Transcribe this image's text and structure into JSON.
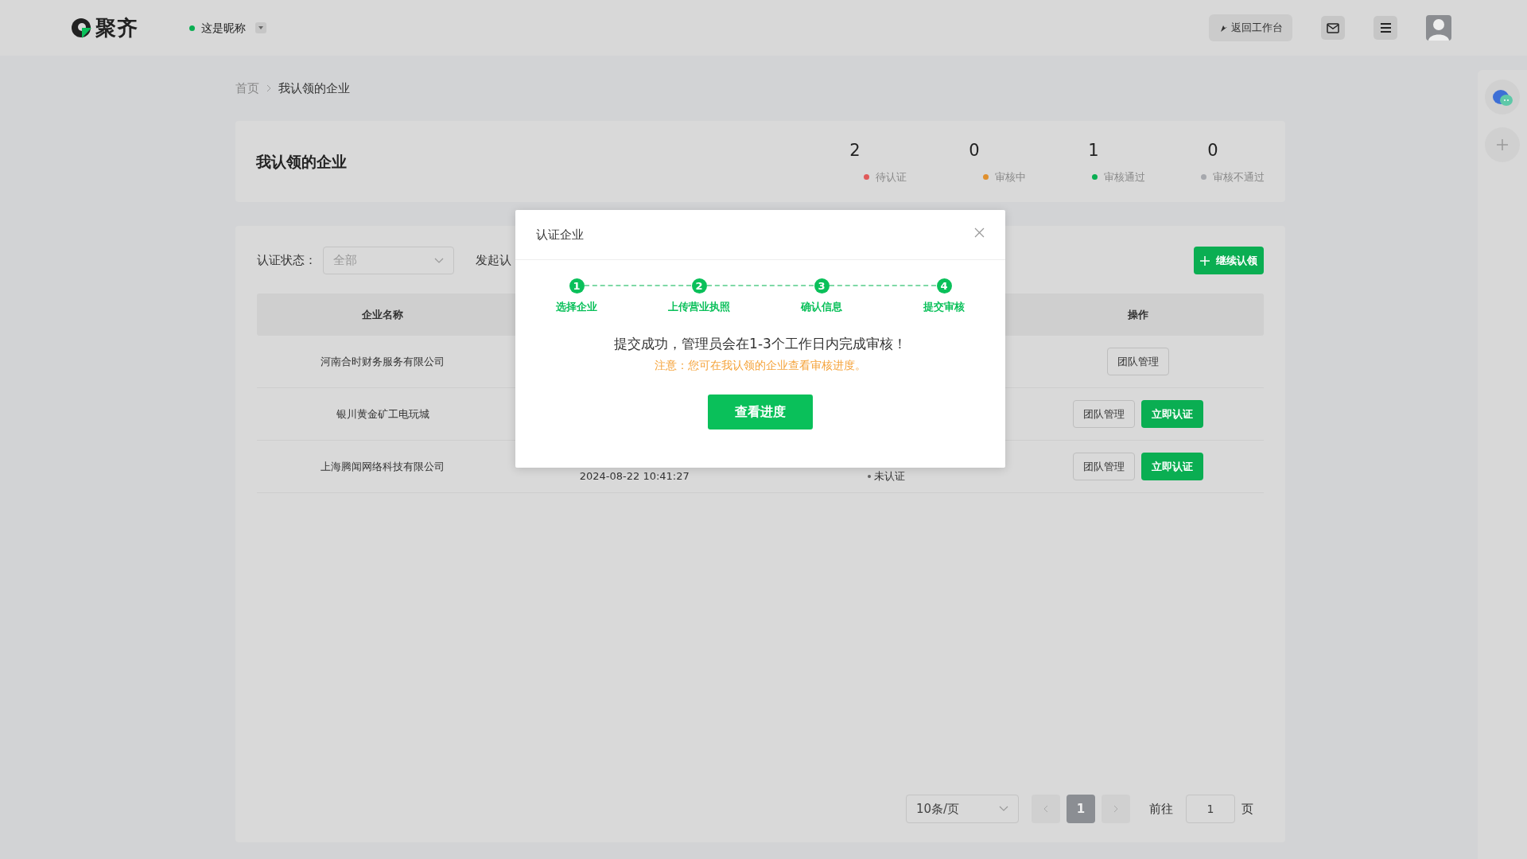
{
  "header": {
    "logo_text": "聚齐",
    "user": {
      "name": "这是昵称",
      "online": true
    },
    "workbench_button": "返回工作台"
  },
  "breadcrumb": [
    {
      "label": "首页",
      "current": false
    },
    {
      "label": "我认领的企业",
      "current": true
    }
  ],
  "summary": {
    "title": "我认领的企业",
    "stats": [
      {
        "count": "2",
        "label": "待认证",
        "color": "#e05a5a"
      },
      {
        "count": "0",
        "label": "审核中",
        "color": "#e0902e"
      },
      {
        "count": "1",
        "label": "审核通过",
        "color": "#0aae52"
      },
      {
        "count": "0",
        "label": "审核不通过",
        "color": "#a6a8ad"
      }
    ]
  },
  "filters": {
    "status_label": "认证状态：",
    "status_value": "全部",
    "date_label": "发起认"
  },
  "add_button": "继续认领",
  "table": {
    "columns": [
      "企业名称",
      "操作"
    ],
    "rows": [
      {
        "name": "河南合时财务服务有限公司",
        "actions": [
          {
            "label": "团队管理",
            "kind": "outline"
          }
        ]
      },
      {
        "name": "银川黄金矿工电玩城",
        "actions": [
          {
            "label": "团队管理",
            "kind": "outline"
          },
          {
            "label": "立即认证",
            "kind": "primary"
          }
        ]
      },
      {
        "name": "上海腾闻网络科技有限公司",
        "date": "2024-08-22 10:41:27",
        "status": "未认证",
        "actions": [
          {
            "label": "团队管理",
            "kind": "outline"
          },
          {
            "label": "立即认证",
            "kind": "primary"
          }
        ]
      }
    ]
  },
  "pagination": {
    "page_size": "10条/页",
    "pages": [
      {
        "label": "1",
        "selected": true
      }
    ],
    "goto_label": "前往",
    "goto_value": "1",
    "page_unit": "页"
  },
  "modal": {
    "title": "认证企业",
    "steps": [
      {
        "number": "1",
        "label": "选择企业",
        "completed": true
      },
      {
        "number": "2",
        "label": "上传营业执照",
        "completed": true
      },
      {
        "number": "3",
        "label": "确认信息",
        "completed": true
      },
      {
        "number": "4",
        "label": "提交审核",
        "completed": true
      }
    ],
    "message": "提交成功，管理员会在1-3个工作日内完成审核！",
    "note": "注意：您可在我认领的企业查看审核进度。",
    "button": "查看进度"
  }
}
